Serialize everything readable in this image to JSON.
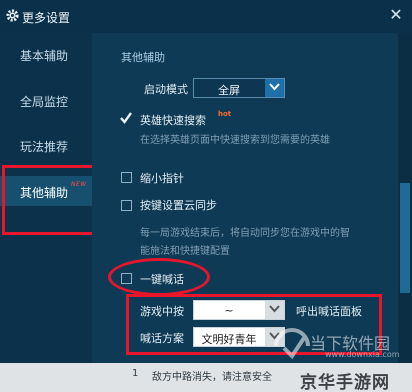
{
  "window": {
    "title": "更多设置",
    "close_glyph": "✕"
  },
  "sidebar": {
    "items": [
      {
        "label": "基本辅助"
      },
      {
        "label": "全局监控"
      },
      {
        "label": "玩法推荐"
      },
      {
        "label": "其他辅助",
        "badge": "NEW"
      }
    ]
  },
  "main": {
    "section_title": "其他辅助",
    "launch_mode": {
      "label": "启动模式",
      "value": "全屏"
    },
    "hero_search": {
      "label": "英雄快速搜索",
      "hot_badge": "hot",
      "checked": true,
      "desc": "在选择英雄页面中快速搜索到您需要的英雄"
    },
    "shrink_pointer": {
      "label": "缩小指针",
      "checked": false
    },
    "cloud_sync": {
      "label": "按键设置云同步",
      "checked": false,
      "desc_line1": "每一局游戏结束后，将自动同步您在游戏中的智",
      "desc_line2": "能施法和快捷键配置"
    },
    "one_key_shout": {
      "label": "一键喊话",
      "checked": false
    },
    "middle_key": {
      "label": "游戏中按",
      "value": "~",
      "suffix": "呼出喊话面板"
    },
    "shout_plan": {
      "label": "喊话方案",
      "value": "文明好青年"
    }
  },
  "bottom": {
    "index": "1",
    "text": "敌方中路消失，请注意安全"
  },
  "watermark": {
    "line1": "当下软件园",
    "line2": "www.downxia.com",
    "line3": "京华手游网"
  },
  "colors": {
    "accent": "#1f6fa8",
    "highlight": "#e8162c",
    "hot": "#ff6a2b"
  }
}
